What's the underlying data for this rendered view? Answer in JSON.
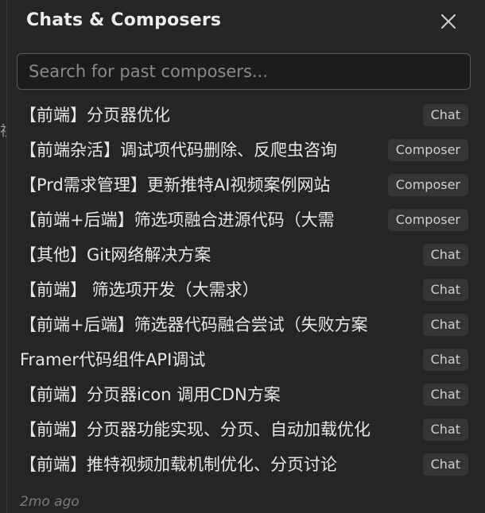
{
  "backdrop": {
    "glyphs": [
      "",
      "视"
    ]
  },
  "header": {
    "title": "Chats & Composers",
    "close_icon": "close-icon"
  },
  "search": {
    "placeholder": "Search for past composers...",
    "value": ""
  },
  "items": [
    {
      "title": "【前端】分页器优化",
      "type": "Chat"
    },
    {
      "title": "【前端杂活】调试项代码删除、反爬虫咨询",
      "type": "Composer"
    },
    {
      "title": "【Prd需求管理】更新推特AI视频案例网站",
      "type": "Composer"
    },
    {
      "title": "【前端+后端】筛选项融合进源代码（大需",
      "type": "Composer"
    },
    {
      "title": "【其他】Git网络解决方案",
      "type": "Chat"
    },
    {
      "title": "【前端】 筛选项开发（大需求）",
      "type": "Chat"
    },
    {
      "title": "【前端+后端】筛选器代码融合尝试（失败方案",
      "type": "Chat"
    },
    {
      "title": "Framer代码组件API调试",
      "type": "Chat"
    },
    {
      "title": "【前端】分页器icon 调用CDN方案",
      "type": "Chat"
    },
    {
      "title": "【前端】分页器功能实现、分页、自动加载优化",
      "type": "Chat"
    },
    {
      "title": "【前端】推特视频加载机制优化、分页讨论",
      "type": "Chat"
    }
  ],
  "footer": {
    "time_label": "2mo ago"
  }
}
